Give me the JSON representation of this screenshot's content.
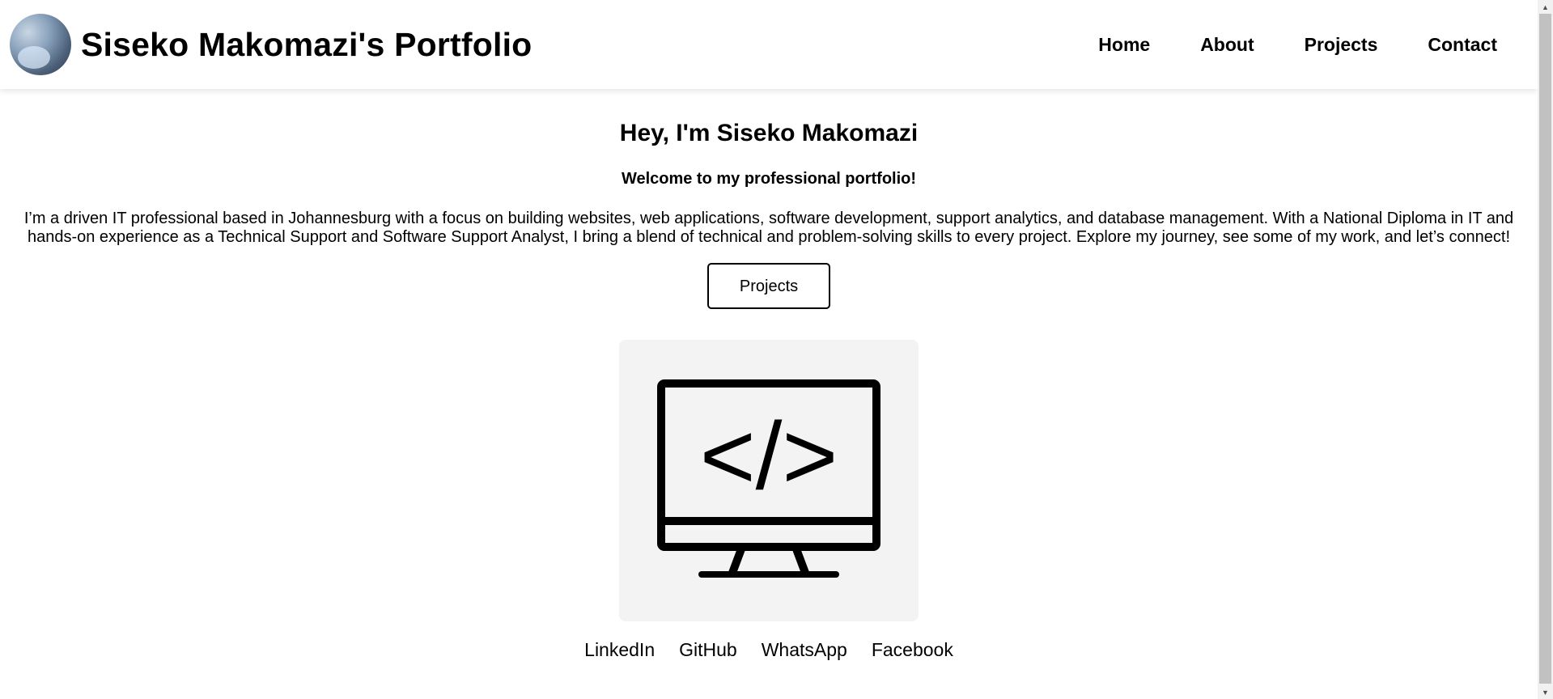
{
  "header": {
    "title": "Siseko Makomazi's Portfolio",
    "nav": [
      "Home",
      "About",
      "Projects",
      "Contact"
    ]
  },
  "hero": {
    "title": "Hey, I'm Siseko Makomazi",
    "subtitle": "Welcome to my professional portfolio!",
    "text": "I’m a driven IT professional based in Johannesburg with a focus on building websites, web applications, software development, support analytics, and database management. With a National Diploma in IT and hands-on experience as a Technical Support and Software Support Analyst, I bring a blend of technical and problem-solving skills to every project. Explore my journey, see some of my work, and let’s connect!",
    "button": "Projects"
  },
  "illustration": {
    "icon": "code-monitor-icon",
    "code_text": "</>"
  },
  "socials": [
    "LinkedIn",
    "GitHub",
    "WhatsApp",
    "Facebook"
  ],
  "colors": {
    "background": "#ffffff",
    "text": "#000000",
    "card": "#f3f3f3"
  }
}
